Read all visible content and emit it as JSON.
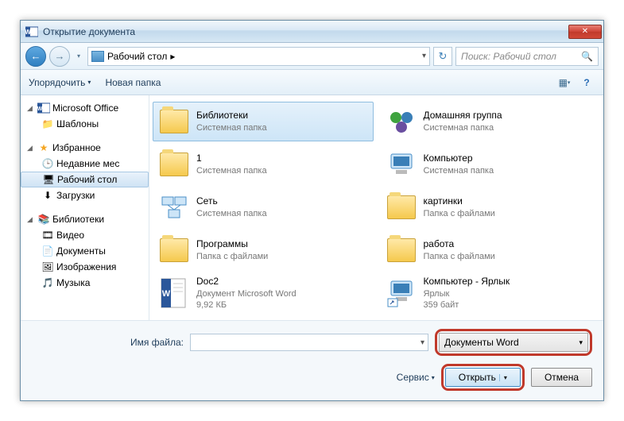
{
  "title": "Открытие документа",
  "breadcrumb": {
    "location": "Рабочий стол",
    "sep": "▸"
  },
  "search": {
    "placeholder": "Поиск: Рабочий стол"
  },
  "toolbar": {
    "organize": "Упорядочить",
    "new_folder": "Новая папка"
  },
  "sidebar": {
    "office": "Microsoft Office",
    "templates": "Шаблоны",
    "favorites": "Избранное",
    "recent": "Недавние мес",
    "desktop": "Рабочий стол",
    "downloads": "Загрузки",
    "libraries": "Библиотеки",
    "video": "Видео",
    "documents": "Документы",
    "pictures": "Изображения",
    "music": "Музыка"
  },
  "items": [
    {
      "name": "Библиотеки",
      "sub": "Системная папка"
    },
    {
      "name": "Домашняя группа",
      "sub": "Системная папка"
    },
    {
      "name": "1",
      "sub": "Системная папка"
    },
    {
      "name": "Компьютер",
      "sub": "Системная папка"
    },
    {
      "name": "Сеть",
      "sub": "Системная папка"
    },
    {
      "name": "картинки",
      "sub": "Папка с файлами"
    },
    {
      "name": "Программы",
      "sub": "Папка с файлами"
    },
    {
      "name": "работа",
      "sub": "Папка с файлами"
    },
    {
      "name": "Doc2",
      "sub": "Документ Microsoft Word",
      "size": "9,92 КБ"
    },
    {
      "name": "Компьютер - Ярлык",
      "sub": "Ярлык",
      "size": "359 байт"
    }
  ],
  "footer": {
    "filename_label": "Имя файла:",
    "filter": "Документы Word",
    "tools": "Сервис",
    "open": "Открыть",
    "cancel": "Отмена"
  }
}
